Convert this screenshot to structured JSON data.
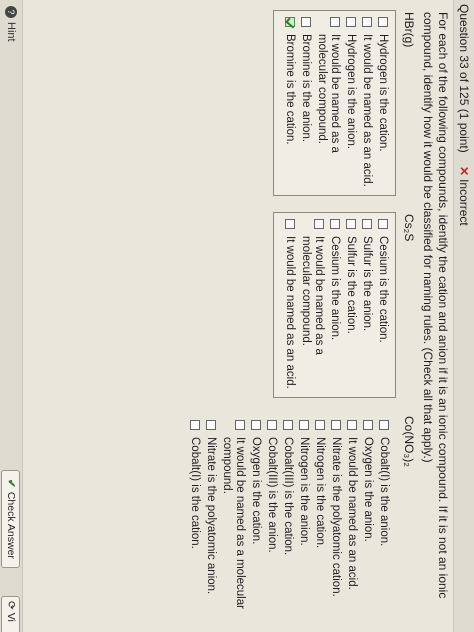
{
  "header": {
    "question_title": "Question 33 of 125 (1 point)",
    "status": "Incorrect"
  },
  "instructions": "For each of the following compounds, identify the cation and anion if it is an ionic compound. If it is not an ionic compound, identify how it would be classified for naming rules. (Check all that apply.)",
  "compounds": [
    {
      "name": "HBr(g)",
      "options": [
        {
          "label": "Hydrogen is the cation.",
          "checked": false
        },
        {
          "label": "It would be named as an acid.",
          "checked": false
        },
        {
          "label": "Hydrogen is the anion.",
          "checked": false
        },
        {
          "label": "It would be named as a molecular compound.",
          "checked": false
        },
        {
          "label": "Bromine is the anion.",
          "checked": false
        },
        {
          "label": "Bromine is the cation.",
          "checked": true
        }
      ]
    },
    {
      "name": "Cs₂S",
      "options": [
        {
          "label": "Cesium is the cation.",
          "checked": false
        },
        {
          "label": "Sulfur is the anion.",
          "checked": false
        },
        {
          "label": "Sulfur is the cation.",
          "checked": false
        },
        {
          "label": "Cesium is the anion.",
          "checked": false
        },
        {
          "label": "It would be named as a molecular compound.",
          "checked": false
        },
        {
          "label": "It would be named as an acid.",
          "checked": false
        }
      ]
    },
    {
      "name": "Co(NO₃)₂",
      "options": [
        {
          "label": "Cobalt(I) is the anion.",
          "checked": false
        },
        {
          "label": "Oxygen is the anion.",
          "checked": false
        },
        {
          "label": "It would be named as an acid.",
          "checked": false
        },
        {
          "label": "Nitrate is the polyatomic cation.",
          "checked": false
        },
        {
          "label": "Nitrogen is the cation.",
          "checked": false
        },
        {
          "label": "Nitrogen is the anion.",
          "checked": false
        },
        {
          "label": "Cobalt(III) is the cation.",
          "checked": false
        },
        {
          "label": "Cobalt(III) is the anion.",
          "checked": false
        },
        {
          "label": "Oxygen is the cation.",
          "checked": false
        },
        {
          "label": "It would be named as a molecular compound.",
          "checked": false
        },
        {
          "label": "Nitrate is the polyatomic anion.",
          "checked": false
        },
        {
          "label": "Cobalt(I) is the cation.",
          "checked": false
        }
      ]
    }
  ],
  "footer": {
    "hint_label": "Hint",
    "check_answer_label": "Check Answer",
    "view_label": "Vi"
  },
  "colors": {
    "incorrect": "#c62828",
    "check": "#2e7d32"
  }
}
